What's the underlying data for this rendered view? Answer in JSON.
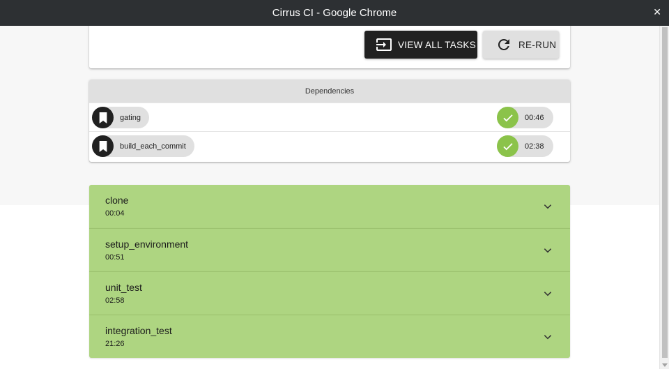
{
  "window": {
    "title": "Cirrus CI - Google Chrome",
    "close_glyph": "✕"
  },
  "actions": {
    "view_all_label": "VIEW ALL TASKS",
    "rerun_label": "RE-RUN"
  },
  "dependencies": {
    "header": "Dependencies",
    "items": [
      {
        "name": "gating",
        "duration": "00:46",
        "status": "success"
      },
      {
        "name": "build_each_commit",
        "duration": "02:38",
        "status": "success"
      }
    ]
  },
  "tasks": [
    {
      "name": "clone",
      "duration": "00:04"
    },
    {
      "name": "setup_environment",
      "duration": "00:51"
    },
    {
      "name": "unit_test",
      "duration": "02:58"
    },
    {
      "name": "integration_test",
      "duration": "21:26"
    }
  ],
  "colors": {
    "success": "#8bc34a",
    "task_bg": "#aed581",
    "dark_button": "#212121"
  },
  "icons": {
    "view_all": "input-arrow-icon",
    "rerun": "refresh-icon",
    "dep": "bookmark-icon",
    "status": "check-icon",
    "expand": "chevron-down-icon"
  }
}
